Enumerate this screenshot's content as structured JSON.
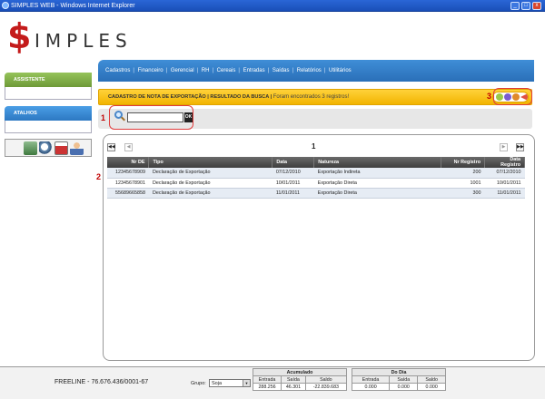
{
  "window": {
    "title": "SIMPLES WEB - Windows Internet Explorer"
  },
  "logo": {
    "dollar": "$",
    "rest": "IMPLES"
  },
  "sidebar": {
    "assistente": "ASSISTENTE",
    "atalhos": "ATALHOS",
    "tools": [
      "calculator-icon",
      "search-icon",
      "calendar-icon",
      "user-icon"
    ]
  },
  "nav": {
    "items": [
      "Cadastros",
      "Financeiro",
      "Gerencial",
      "RH",
      "Cereais",
      "Entradas",
      "Saídas",
      "Relatórios",
      "Utilitários"
    ],
    "separator": "|"
  },
  "crumb": {
    "title": "CADASTRO DE NOTA DE EXPORTAÇÃO | RESULTADO DA BUSCA |",
    "found": "Foram encontrados 3 registros!"
  },
  "search": {
    "value": "",
    "ok": "OK"
  },
  "annotations": {
    "one": "1",
    "two": "2",
    "three": "3"
  },
  "pager": {
    "page": "1",
    "first": "◀◀",
    "prev": "◀",
    "next": "▶",
    "last": "▶▶"
  },
  "table": {
    "headers": [
      "Nr DE",
      "Tipo",
      "Data",
      "Natureza",
      "Nr Registro",
      "Data Registro"
    ],
    "rows": [
      [
        "12345678909",
        "Declaração de Exportação",
        "07/12/2010",
        "Exportação Indireta",
        "200",
        "07/12/2010"
      ],
      [
        "12345678901",
        "Declaração de Exportação",
        "10/01/2011",
        "Exportação Direta",
        "1001",
        "10/01/2011"
      ],
      [
        "55689665858",
        "Declaração de Exportação",
        "11/01/2011",
        "Exportação Direta",
        "300",
        "11/01/2011"
      ]
    ]
  },
  "status": {
    "freeline": "FREELINE - 76.676.436/0001-67",
    "grupo_label": "Grupo:",
    "grupo_value": "Soja",
    "acumulado": {
      "title": "Acumulado",
      "cols": [
        "Entrada",
        "Saída",
        "Saldo"
      ],
      "vals": [
        "288.256",
        "46.301",
        "-22.839.683"
      ]
    },
    "dodia": {
      "title": "Do Dia",
      "cols": [
        "Entrada",
        "Saída",
        "Saldo"
      ],
      "vals": [
        "0.000",
        "0.000",
        "0.000"
      ]
    }
  },
  "colors": {
    "nav": "#3f8ed7",
    "crumb": "#ffd23a",
    "annotation": "#e03c3c",
    "assistente": "#7fae45",
    "atalhos": "#3a8ad4"
  }
}
